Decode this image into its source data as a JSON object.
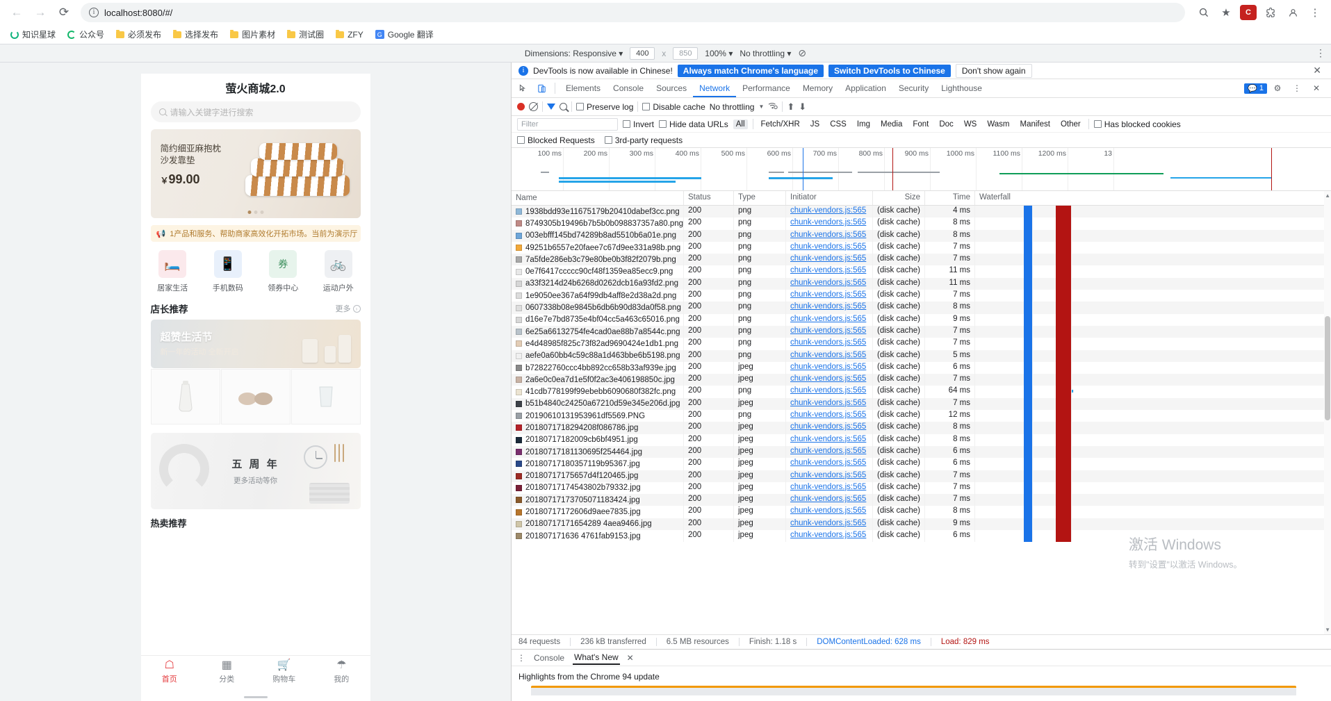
{
  "browser": {
    "back_icon": "←",
    "forward_icon": "→",
    "reload_icon": "⟳",
    "url": "localhost:8080/#/",
    "zoom_icon": "search-icon",
    "star_icon": "★",
    "profile_label": "C",
    "extensions_icon": "🧩",
    "account_icon": "👤",
    "menu_icon": "⋮",
    "bookmarks": [
      {
        "label": "知识星球",
        "icon": "ring-teal"
      },
      {
        "label": "公众号",
        "icon": "ring-green"
      },
      {
        "label": "必须发布",
        "icon": "folder"
      },
      {
        "label": "选择发布",
        "icon": "folder"
      },
      {
        "label": "图片素材",
        "icon": "folder"
      },
      {
        "label": "测试圈",
        "icon": "folder"
      },
      {
        "label": "ZFY",
        "icon": "folder"
      },
      {
        "label": "Google 翻译",
        "icon": "google-translate"
      }
    ]
  },
  "device_bar": {
    "dimensions_label": "Dimensions: Responsive",
    "width": "400",
    "height": "850",
    "zoom": "100%",
    "throttling": "No throttling",
    "rotate_icon": "⌀",
    "menu_icon": "⋮"
  },
  "phone": {
    "title": "萤火商城2.0",
    "search_placeholder": "请输入关键字进行搜索",
    "banner": {
      "line1": "简约细亚麻抱枕",
      "line2": "沙发靠垫",
      "currency": "￥",
      "price": "99.00"
    },
    "notice": "1产品和服务、帮助商家高效化开拓市场。当前为演示厅",
    "categories": [
      {
        "label": "居家生活",
        "icon": "🛏"
      },
      {
        "label": "手机数码",
        "icon": "📱"
      },
      {
        "label": "领券中心",
        "icon": "券"
      },
      {
        "label": "运动户外",
        "icon": "🚴"
      }
    ],
    "recommend": {
      "title": "店长推荐",
      "more": "更多"
    },
    "promo": {
      "title": "超赞生活节",
      "subtitle": "新一年的活动 全新开启"
    },
    "anniversary": {
      "title": "五 周 年",
      "subtitle": "更多活动等你"
    },
    "hot_title": "热卖推荐",
    "tabbar": [
      {
        "label": "首页",
        "icon": "⌂",
        "active": true
      },
      {
        "label": "分类",
        "icon": "▦",
        "active": false
      },
      {
        "label": "购物车",
        "icon": "🛒",
        "active": false
      },
      {
        "label": "我的",
        "icon": "👤",
        "active": false
      }
    ]
  },
  "devtools": {
    "banner": {
      "text": "DevTools is now available in Chinese!",
      "btn_always": "Always match Chrome's language",
      "btn_switch": "Switch DevTools to Chinese",
      "btn_dismiss": "Don't show again",
      "close_icon": "✕"
    },
    "tabs": [
      "Elements",
      "Console",
      "Sources",
      "Network",
      "Performance",
      "Memory",
      "Application",
      "Security",
      "Lighthouse"
    ],
    "active_tab": "Network",
    "warning_count": "1",
    "settings_icon": "⚙",
    "more_icon": "⋮",
    "close_icon": "✕",
    "controls": {
      "preserve_log": "Preserve log",
      "disable_cache": "Disable cache",
      "throttling": "No throttling"
    },
    "filter": {
      "placeholder": "Filter",
      "invert": "Invert",
      "hide_data_urls": "Hide data URLs",
      "types": [
        "All",
        "Fetch/XHR",
        "JS",
        "CSS",
        "Img",
        "Media",
        "Font",
        "Doc",
        "WS",
        "Wasm",
        "Manifest",
        "Other"
      ],
      "active_type": "All",
      "has_blocked_cookies": "Has blocked cookies",
      "blocked_requests": "Blocked Requests",
      "third_party": "3rd-party requests"
    },
    "overview_ticks": [
      "100 ms",
      "200 ms",
      "300 ms",
      "400 ms",
      "500 ms",
      "600 ms",
      "700 ms",
      "800 ms",
      "900 ms",
      "1000 ms",
      "1100 ms",
      "1200 ms",
      "13"
    ],
    "columns": [
      "Name",
      "Status",
      "Type",
      "Initiator",
      "Size",
      "Time",
      "Waterfall"
    ],
    "rows": [
      {
        "name": "1938bdd93e11675179b20410dabef3cc.png",
        "status": "200",
        "type": "png",
        "initiator": "chunk-vendors.js:565",
        "size": "(disk cache)",
        "time": "4 ms",
        "icon_color": "#8fb8d8"
      },
      {
        "name": "8749305b19496b7b5b0b098837357a80.png",
        "status": "200",
        "type": "png",
        "initiator": "chunk-vendors.js:565",
        "size": "(disk cache)",
        "time": "8 ms",
        "icon_color": "#c08a86"
      },
      {
        "name": "003ebfff145bd74289b8ad5510b6a01e.png",
        "status": "200",
        "type": "png",
        "initiator": "chunk-vendors.js:565",
        "size": "(disk cache)",
        "time": "8 ms",
        "icon_color": "#6ea6d9"
      },
      {
        "name": "49251b6557e20faee7c67d9ee331a98b.png",
        "status": "200",
        "type": "png",
        "initiator": "chunk-vendors.js:565",
        "size": "(disk cache)",
        "time": "7 ms",
        "icon_color": "#f2a93b"
      },
      {
        "name": "7a5fde286eb3c79e80be0b3f82f2079b.png",
        "status": "200",
        "type": "png",
        "initiator": "chunk-vendors.js:565",
        "size": "(disk cache)",
        "time": "7 ms",
        "icon_color": "#a9a9a9"
      },
      {
        "name": "0e7f6417ccccc90cf48f1359ea85ecc9.png",
        "status": "200",
        "type": "png",
        "initiator": "chunk-vendors.js:565",
        "size": "(disk cache)",
        "time": "11 ms",
        "icon_color": "#e8e8e8"
      },
      {
        "name": "a33f3214d24b6268d0262dcb16a93fd2.png",
        "status": "200",
        "type": "png",
        "initiator": "chunk-vendors.js:565",
        "size": "(disk cache)",
        "time": "11 ms",
        "icon_color": "#d6d6d6"
      },
      {
        "name": "1e9050ee367a64f99db4aff8e2d38a2d.png",
        "status": "200",
        "type": "png",
        "initiator": "chunk-vendors.js:565",
        "size": "(disk cache)",
        "time": "7 ms",
        "icon_color": "#dcdcdc"
      },
      {
        "name": "0607338b08e9845b6db6b90d83da0f58.png",
        "status": "200",
        "type": "png",
        "initiator": "chunk-vendors.js:565",
        "size": "(disk cache)",
        "time": "8 ms",
        "icon_color": "#dedede"
      },
      {
        "name": "d16e7e7bd8735e4bf04cc5a463c65016.png",
        "status": "200",
        "type": "png",
        "initiator": "chunk-vendors.js:565",
        "size": "(disk cache)",
        "time": "9 ms",
        "icon_color": "#d8d8d8"
      },
      {
        "name": "6e25a66132754fe4cad0ae88b7a8544c.png",
        "status": "200",
        "type": "png",
        "initiator": "chunk-vendors.js:565",
        "size": "(disk cache)",
        "time": "7 ms",
        "icon_color": "#b9c3cb"
      },
      {
        "name": "e4d48985f825c73f82ad9690424e1db1.png",
        "status": "200",
        "type": "png",
        "initiator": "chunk-vendors.js:565",
        "size": "(disk cache)",
        "time": "7 ms",
        "icon_color": "#e3cdb6"
      },
      {
        "name": "aefe0a60bb4c59c88a1d463bbe6b5198.png",
        "status": "200",
        "type": "png",
        "initiator": "chunk-vendors.js:565",
        "size": "(disk cache)",
        "time": "5 ms",
        "icon_color": "#f0f0f0"
      },
      {
        "name": "b72822760ccc4bb892cc658b33af939e.jpg",
        "status": "200",
        "type": "jpeg",
        "initiator": "chunk-vendors.js:565",
        "size": "(disk cache)",
        "time": "6 ms",
        "icon_color": "#8a8a8a"
      },
      {
        "name": "2a6e0c0ea7d1e5f0f2ac3e406198850c.jpg",
        "status": "200",
        "type": "jpeg",
        "initiator": "chunk-vendors.js:565",
        "size": "(disk cache)",
        "time": "7 ms",
        "icon_color": "#c9b3a5"
      },
      {
        "name": "41cdb778199f99ebebb6090680f382fc.png",
        "status": "200",
        "type": "png",
        "initiator": "chunk-vendors.js:565",
        "size": "(disk cache)",
        "time": "64 ms",
        "icon_color": "#ece4d2"
      },
      {
        "name": "b51b4840c24250a67210d59e345e206d.jpg",
        "status": "200",
        "type": "jpeg",
        "initiator": "chunk-vendors.js:565",
        "size": "(disk cache)",
        "time": "7 ms",
        "icon_color": "#3d4147"
      },
      {
        "name": "20190610131953961df5569.PNG",
        "status": "200",
        "type": "png",
        "initiator": "chunk-vendors.js:565",
        "size": "(disk cache)",
        "time": "12 ms",
        "icon_color": "#9aa0a6"
      },
      {
        "name": "2018071718294208f086786.jpg",
        "status": "200",
        "type": "jpeg",
        "initiator": "chunk-vendors.js:565",
        "size": "(disk cache)",
        "time": "8 ms",
        "icon_color": "#b5232a"
      },
      {
        "name": "20180717182009cb6bf4951.jpg",
        "status": "200",
        "type": "jpeg",
        "initiator": "chunk-vendors.js:565",
        "size": "(disk cache)",
        "time": "8 ms",
        "icon_color": "#1b2a3a"
      },
      {
        "name": "20180717181130695f254464.jpg",
        "status": "200",
        "type": "jpeg",
        "initiator": "chunk-vendors.js:565",
        "size": "(disk cache)",
        "time": "6 ms",
        "icon_color": "#7a2f6e"
      },
      {
        "name": "20180717180357119b95367.jpg",
        "status": "200",
        "type": "jpeg",
        "initiator": "chunk-vendors.js:565",
        "size": "(disk cache)",
        "time": "6 ms",
        "icon_color": "#2b4a8a"
      },
      {
        "name": "20180717175657d4f120465.jpg",
        "status": "200",
        "type": "jpeg",
        "initiator": "chunk-vendors.js:565",
        "size": "(disk cache)",
        "time": "7 ms",
        "icon_color": "#9c2b24"
      },
      {
        "name": "20180717174543802b79332.jpg",
        "status": "200",
        "type": "jpeg",
        "initiator": "chunk-vendors.js:565",
        "size": "(disk cache)",
        "time": "7 ms",
        "icon_color": "#7a2038"
      },
      {
        "name": "20180717173705071183424.jpg",
        "status": "200",
        "type": "jpeg",
        "initiator": "chunk-vendors.js:565",
        "size": "(disk cache)",
        "time": "7 ms",
        "icon_color": "#8a5a2b"
      },
      {
        "name": "20180717172606d9aee7835.jpg",
        "status": "200",
        "type": "jpeg",
        "initiator": "chunk-vendors.js:565",
        "size": "(disk cache)",
        "time": "8 ms",
        "icon_color": "#b8762c"
      },
      {
        "name": "20180717171654289 4aea9466.jpg",
        "status": "200",
        "type": "jpeg",
        "initiator": "chunk-vendors.js:565",
        "size": "(disk cache)",
        "time": "9 ms",
        "icon_color": "#d0c6a8"
      },
      {
        "name": "201807171636 4761fab9153.jpg",
        "status": "200",
        "type": "jpeg",
        "initiator": "chunk-vendors.js:565",
        "size": "(disk cache)",
        "time": "6 ms",
        "icon_color": "#9d8a6a"
      }
    ],
    "status": {
      "requests": "84 requests",
      "transferred": "236 kB transferred",
      "resources": "6.5 MB resources",
      "finish": "Finish: 1.18 s",
      "dom_loaded": "DOMContentLoaded: 628 ms",
      "load": "Load: 829 ms"
    },
    "drawer": {
      "menu_icon": "⋮",
      "tabs": [
        "Console",
        "What's New"
      ],
      "active_tab": "What's New",
      "close_icon": "✕",
      "heading": "Highlights from the Chrome 94 update"
    }
  },
  "watermark": {
    "line1": "激活 Windows",
    "line2": "转到\"设置\"以激活 Windows。"
  }
}
